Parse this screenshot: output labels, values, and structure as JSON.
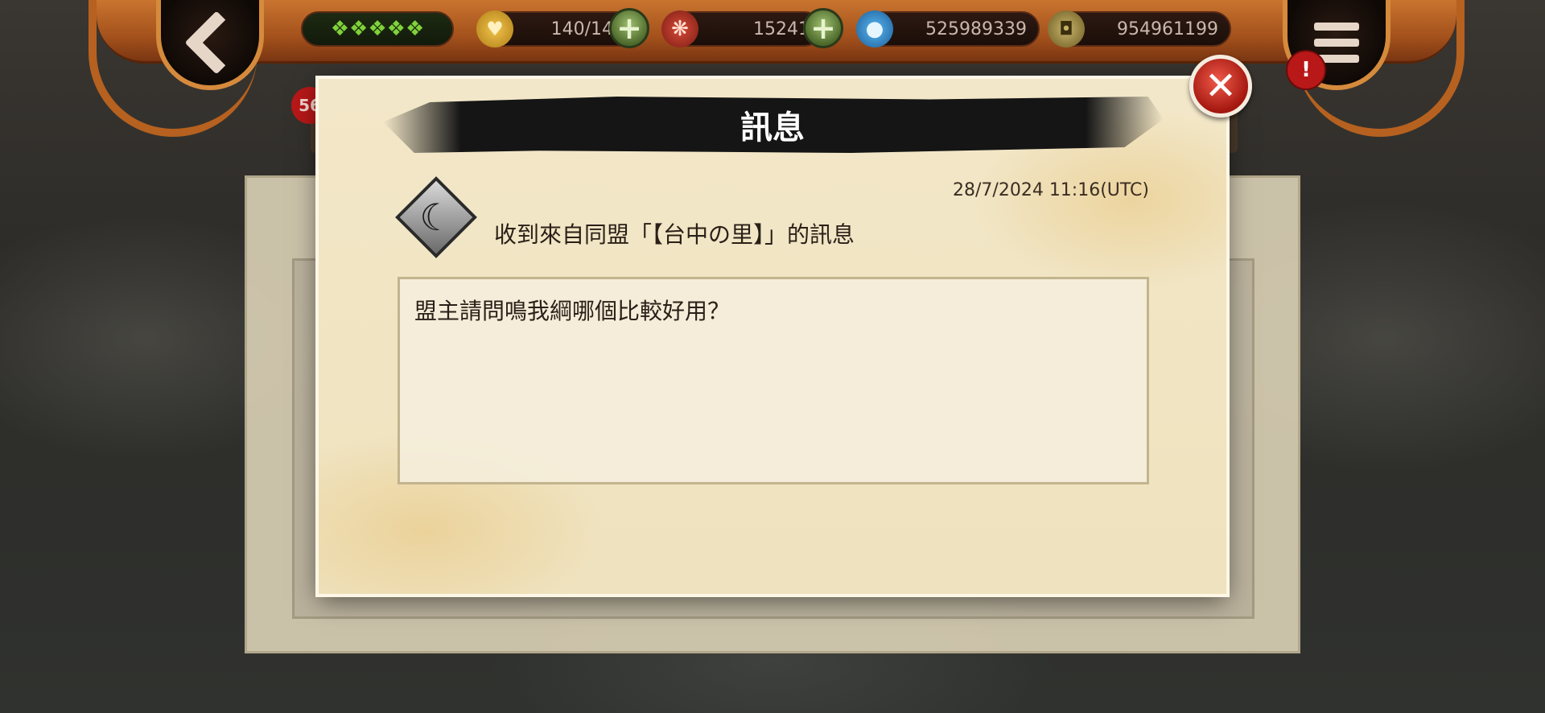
{
  "hud": {
    "rank_stars": "❖❖❖❖❖",
    "stamina": "140/140",
    "scrolls": "15241",
    "chakra": "525989339",
    "coins": "954961199",
    "alert": "!",
    "badge_count": "56"
  },
  "dialog": {
    "title": "訊息",
    "close_glyph": "✕",
    "timestamp": "28/7/2024 11:16(UTC)",
    "sender_line": "收到來自同盟「【台中の里】」的訊息",
    "message": "盟主請問鳴我綱哪個比較好用？"
  },
  "colors": {
    "top_bar": "#a4511c",
    "close_button": "#c1271a",
    "parchment": "#f0e4c4",
    "title_band": "#151515",
    "plus_button": "#6e8f44"
  },
  "icons": {
    "back": "back-arrow-icon",
    "menu": "menu-icon",
    "stamina": "heart-icon",
    "scrolls": "scroll-icon",
    "chakra": "chakra-drop-icon",
    "coins": "coin-icon",
    "close": "close-icon",
    "emblem": "clan-emblem-icon"
  }
}
